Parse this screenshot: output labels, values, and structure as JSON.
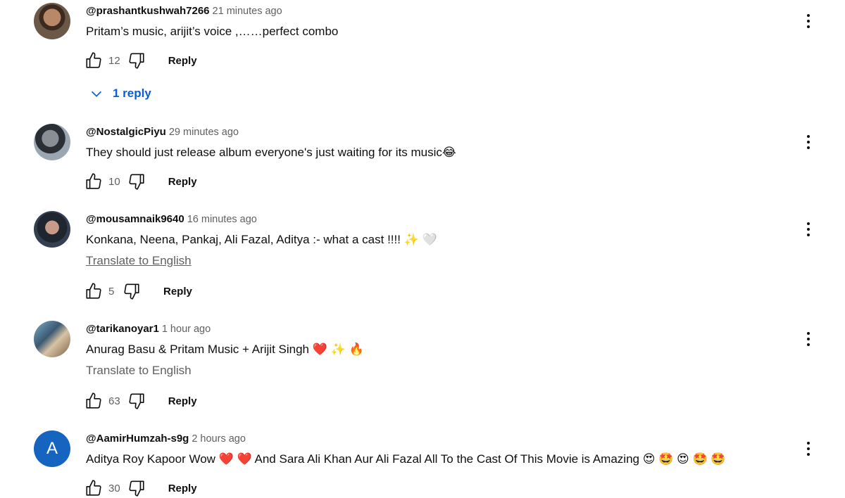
{
  "comments": [
    {
      "author": "@prashantkushwah7266",
      "time": "21 minutes ago",
      "text": "Pritam’s music, arijit’s voice ,……perfect combo",
      "likes": "12",
      "reply_label": "Reply",
      "replies_label": "1 reply"
    },
    {
      "author": "@NostalgicPiyu",
      "time": "29 minutes ago",
      "text": "They should just release album everyone's just waiting for its music😂",
      "likes": "10",
      "reply_label": "Reply"
    },
    {
      "author": "@mousamnaik9640",
      "time": "16 minutes ago",
      "text": "Konkana, Neena, Pankaj, Ali Fazal, Aditya :- what a cast !!!! ✨ 🤍",
      "translate": "Translate to English",
      "likes": "5",
      "reply_label": "Reply"
    },
    {
      "author": "@tarikanoyar1",
      "time": "1 hour ago",
      "text": "Anurag Basu & Pritam Music + Arijit Singh ❤️ ✨ 🔥",
      "translate": "Translate to English",
      "likes": "63",
      "reply_label": "Reply"
    },
    {
      "author": "@AamirHumzah-s9g",
      "avatar_letter": "A",
      "time": "2 hours ago",
      "text": "Aditya Roy Kapoor Wow ❤️ ❤️  And Sara Ali Khan Aur Ali Fazal All To the Cast Of This Movie is Amazing 😍 🤩 😍 🤩 🤩",
      "likes": "30",
      "reply_label": "Reply"
    }
  ],
  "colors": {
    "link_blue": "#065fd4",
    "secondary_text": "#606060",
    "avatar_a": "#1565c0"
  },
  "icons": [
    "thumbs-up-icon",
    "thumbs-down-icon",
    "more-vert-icon",
    "chevron-down-icon"
  ]
}
